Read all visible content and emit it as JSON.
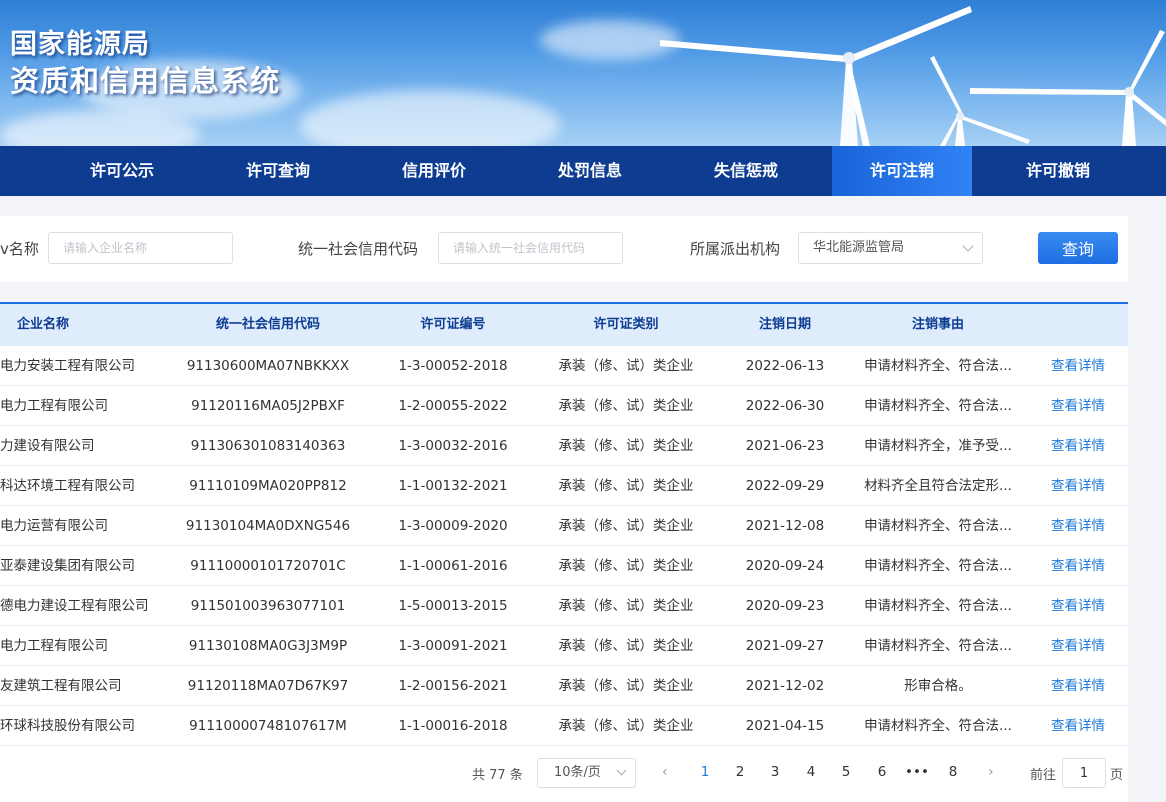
{
  "banner": {
    "title_line1": "国家能源局",
    "title_line2": "资质和信用信息系统"
  },
  "nav": {
    "items": [
      {
        "label": "许可公示",
        "active": false
      },
      {
        "label": "许可查询",
        "active": false
      },
      {
        "label": "信用评价",
        "active": false
      },
      {
        "label": "处罚信息",
        "active": false
      },
      {
        "label": "失信惩戒",
        "active": false
      },
      {
        "label": "许可注销",
        "active": true
      },
      {
        "label": "许可撤销",
        "active": false
      }
    ]
  },
  "search": {
    "company_label": "v名称",
    "company_placeholder": "请输入企业名称",
    "credit_label": "统一社会信用代码",
    "credit_placeholder": "请输入统一社会信用代码",
    "agency_label": "所属派出机构",
    "agency_value": "华北能源监管局",
    "search_button": "查询"
  },
  "table": {
    "headers": [
      "企业名称",
      "统一社会信用代码",
      "许可证编号",
      "许可证类别",
      "注销日期",
      "注销事由",
      ""
    ],
    "action_label": "查看详情",
    "rows": [
      {
        "name": "电力安装工程有限公司",
        "code": "91130600MA07NBKKXX",
        "license": "1-3-00052-2018",
        "type": "承装（修、试）类企业",
        "date": "2022-06-13",
        "reason": "申请材料齐全、符合法..."
      },
      {
        "name": "电力工程有限公司",
        "code": "91120116MA05J2PBXF",
        "license": "1-2-00055-2022",
        "type": "承装（修、试）类企业",
        "date": "2022-06-30",
        "reason": "申请材料齐全、符合法..."
      },
      {
        "name": "力建设有限公司",
        "code": "911306301083140363",
        "license": "1-3-00032-2016",
        "type": "承装（修、试）类企业",
        "date": "2021-06-23",
        "reason": "申请材料齐全，准予受..."
      },
      {
        "name": "科达环境工程有限公司",
        "code": "91110109MA020PP812",
        "license": "1-1-00132-2021",
        "type": "承装（修、试）类企业",
        "date": "2022-09-29",
        "reason": "材料齐全且符合法定形..."
      },
      {
        "name": "电力运营有限公司",
        "code": "91130104MA0DXNG546",
        "license": "1-3-00009-2020",
        "type": "承装（修、试）类企业",
        "date": "2021-12-08",
        "reason": "申请材料齐全、符合法..."
      },
      {
        "name": "亚泰建设集团有限公司",
        "code": "91110000101720701C",
        "license": "1-1-00061-2016",
        "type": "承装（修、试）类企业",
        "date": "2020-09-24",
        "reason": "申请材料齐全、符合法..."
      },
      {
        "name": "德电力建设工程有限公司",
        "code": "911501003963077101",
        "license": "1-5-00013-2015",
        "type": "承装（修、试）类企业",
        "date": "2020-09-23",
        "reason": "申请材料齐全、符合法..."
      },
      {
        "name": "电力工程有限公司",
        "code": "91130108MA0G3J3M9P",
        "license": "1-3-00091-2021",
        "type": "承装（修、试）类企业",
        "date": "2021-09-27",
        "reason": "申请材料齐全、符合法..."
      },
      {
        "name": "友建筑工程有限公司",
        "code": "91120118MA07D67K97",
        "license": "1-2-00156-2021",
        "type": "承装（修、试）类企业",
        "date": "2021-12-02",
        "reason": "形审合格。"
      },
      {
        "name": "环球科技股份有限公司",
        "code": "91110000748107617M",
        "license": "1-1-00016-2018",
        "type": "承装（修、试）类企业",
        "date": "2021-04-15",
        "reason": "申请材料齐全、符合法..."
      }
    ]
  },
  "pagination": {
    "total": "共 77 条",
    "page_size": "10条/页",
    "prev": "‹",
    "next": "›",
    "pages": [
      "1",
      "2",
      "3",
      "4",
      "5",
      "6",
      "•••",
      "8"
    ],
    "current": "1",
    "goto_prefix": "前往",
    "goto_value": "1",
    "goto_suffix": "页"
  }
}
